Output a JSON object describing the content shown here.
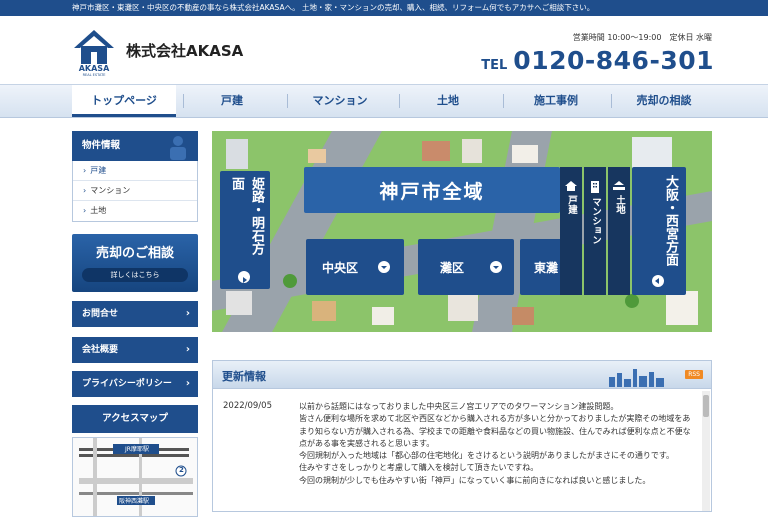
{
  "topbar": {
    "text": "神戸市灘区・東灘区・中央区の不動産の事なら株式会社AKASAへ。 土地・家・マンションの売却、購入、相続、リフォーム何でもアカサへご相談下さい。"
  },
  "header": {
    "logo_text": "AKASA",
    "logo_subtext": "REAL ESTATE",
    "company_name": "株式会社AKASA",
    "hours": "営業時間 10:00〜19:00　定休日 水曜",
    "tel_label": "TEL",
    "tel_number": "0120-846-301"
  },
  "nav": {
    "items": [
      {
        "label": "トップページ"
      },
      {
        "label": "戸建"
      },
      {
        "label": "マンション"
      },
      {
        "label": "土地"
      },
      {
        "label": "施工事例"
      },
      {
        "label": "売却の相談"
      }
    ]
  },
  "sidebar": {
    "property_head": "物件情報",
    "property_items": [
      "戸建",
      "マンション",
      "土地"
    ],
    "sale_title": "売却のご相談",
    "sale_button": "詳しくはこちら",
    "contact": "お問合せ",
    "company": "会社概要",
    "privacy": "プライバシーポリシー",
    "access": "アクセスマップ",
    "map_label_1": "JR摩耶駅",
    "map_label_2": "阪神西灘駅",
    "map_number": "2"
  },
  "hero": {
    "left_panel": "姫路・明石方面",
    "main_title": "神戸市全域",
    "districts": [
      "中央区",
      "灘区",
      "東灘"
    ],
    "tabs": [
      "戸建",
      "マンション",
      "土地"
    ],
    "right_panel": "大阪・西宮方面"
  },
  "news": {
    "title": "更新情報",
    "rss": "RSS",
    "date": "2022/09/05",
    "paragraphs": [
      "以前から話題にはなっておりました中央区三ノ宮エリアでのタワーマンション建設問題。",
      "皆さん便利な場所を求めて北区や西区などから購入される方が多いと分かっておりましたが実際その地域をあまり知らない方が購入される為、学校までの距離や食料品などの買い物施設、住んでみれば便利な点と不便な点がある事を実感されると思います。",
      "今回規制が入った地域は「都心部の住宅地化」をさけるという説明がありましたがまさにその通りです。",
      "住みやすさをしっかりと考慮して購入を検討して頂きたいですね。",
      "今回の規制が少しでも住みやすい街「神戸」になっていく事に前向きになれば良いと感じました。"
    ]
  },
  "colors": {
    "brand": "#1f4e8c",
    "accent_orange": "#f08a24"
  }
}
